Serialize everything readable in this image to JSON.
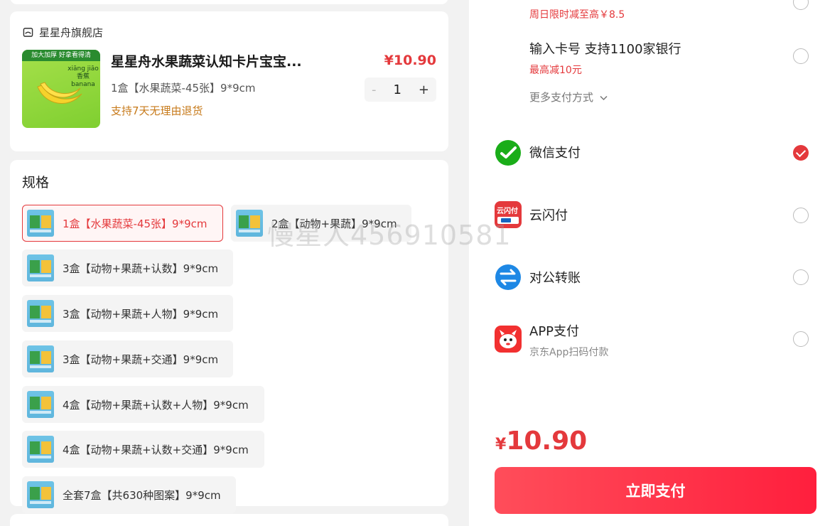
{
  "order": {
    "shop_name": "星星舟旗舰店",
    "product_title": "星星舟水果蔬菜认知卡片宝宝...",
    "price": "¥10.90",
    "spec_text": "1盒【水果蔬菜-45张】9*9cm",
    "return_policy": "支持7天无理由退货",
    "quantity": "1",
    "minus": "-",
    "plus": "+",
    "thumb_banner": "加大加厚 好拿看得清",
    "thumb_word": "xiāng jiāo 香蕉 banana"
  },
  "spec": {
    "title": "规格",
    "options": [
      "1盒【水果蔬菜-45张】9*9cm",
      "2盒【动物+果蔬】9*9cm",
      "3盒【动物+果蔬+认数】9*9cm",
      "3盒【动物+果蔬+人物】9*9cm",
      "3盒【动物+果蔬+交通】9*9cm",
      "4盒【动物+果蔬+认数+人物】9*9cm",
      "4盒【动物+果蔬+认数+交通】9*9cm",
      "全套7盒【共630种图案】9*9cm"
    ],
    "selected_index": 0
  },
  "watermark": "慢星人456910581",
  "payment": {
    "promo_top": "周日限时减至高￥8.5",
    "card_input": {
      "name": "输入卡号 支持1100家银行",
      "promo": "最高减10元"
    },
    "more_label": "更多支付方式",
    "methods": [
      {
        "name": "微信支付",
        "icon": "wechat-pay-icon",
        "checked": true
      },
      {
        "name": "云闪付",
        "icon": "unionpay-quickpass-icon",
        "checked": false
      },
      {
        "name": "对公转账",
        "icon": "transfer-icon",
        "checked": false
      },
      {
        "name": "APP支付",
        "sub": "京东App扫码付款",
        "icon": "jd-app-icon",
        "checked": false
      }
    ],
    "unionpay_icon_text": "云闪付"
  },
  "checkout": {
    "currency": "¥",
    "total": "10.90",
    "pay_button": "立即支付"
  },
  "colors": {
    "accent": "#e4393c",
    "wechat": "#1aad19",
    "transfer": "#1e88e5"
  }
}
